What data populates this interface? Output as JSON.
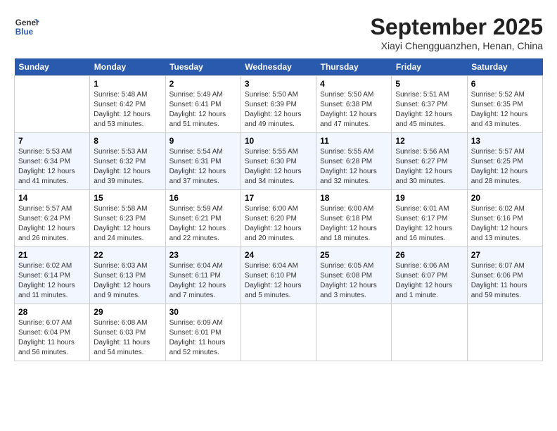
{
  "header": {
    "logo_line1": "General",
    "logo_line2": "Blue",
    "month": "September 2025",
    "location": "Xiayi Chengguanzhen, Henan, China"
  },
  "weekdays": [
    "Sunday",
    "Monday",
    "Tuesday",
    "Wednesday",
    "Thursday",
    "Friday",
    "Saturday"
  ],
  "weeks": [
    [
      {
        "day": "",
        "sunrise": "",
        "sunset": "",
        "daylight": ""
      },
      {
        "day": "1",
        "sunrise": "Sunrise: 5:48 AM",
        "sunset": "Sunset: 6:42 PM",
        "daylight": "Daylight: 12 hours and 53 minutes."
      },
      {
        "day": "2",
        "sunrise": "Sunrise: 5:49 AM",
        "sunset": "Sunset: 6:41 PM",
        "daylight": "Daylight: 12 hours and 51 minutes."
      },
      {
        "day": "3",
        "sunrise": "Sunrise: 5:50 AM",
        "sunset": "Sunset: 6:39 PM",
        "daylight": "Daylight: 12 hours and 49 minutes."
      },
      {
        "day": "4",
        "sunrise": "Sunrise: 5:50 AM",
        "sunset": "Sunset: 6:38 PM",
        "daylight": "Daylight: 12 hours and 47 minutes."
      },
      {
        "day": "5",
        "sunrise": "Sunrise: 5:51 AM",
        "sunset": "Sunset: 6:37 PM",
        "daylight": "Daylight: 12 hours and 45 minutes."
      },
      {
        "day": "6",
        "sunrise": "Sunrise: 5:52 AM",
        "sunset": "Sunset: 6:35 PM",
        "daylight": "Daylight: 12 hours and 43 minutes."
      }
    ],
    [
      {
        "day": "7",
        "sunrise": "Sunrise: 5:53 AM",
        "sunset": "Sunset: 6:34 PM",
        "daylight": "Daylight: 12 hours and 41 minutes."
      },
      {
        "day": "8",
        "sunrise": "Sunrise: 5:53 AM",
        "sunset": "Sunset: 6:32 PM",
        "daylight": "Daylight: 12 hours and 39 minutes."
      },
      {
        "day": "9",
        "sunrise": "Sunrise: 5:54 AM",
        "sunset": "Sunset: 6:31 PM",
        "daylight": "Daylight: 12 hours and 37 minutes."
      },
      {
        "day": "10",
        "sunrise": "Sunrise: 5:55 AM",
        "sunset": "Sunset: 6:30 PM",
        "daylight": "Daylight: 12 hours and 34 minutes."
      },
      {
        "day": "11",
        "sunrise": "Sunrise: 5:55 AM",
        "sunset": "Sunset: 6:28 PM",
        "daylight": "Daylight: 12 hours and 32 minutes."
      },
      {
        "day": "12",
        "sunrise": "Sunrise: 5:56 AM",
        "sunset": "Sunset: 6:27 PM",
        "daylight": "Daylight: 12 hours and 30 minutes."
      },
      {
        "day": "13",
        "sunrise": "Sunrise: 5:57 AM",
        "sunset": "Sunset: 6:25 PM",
        "daylight": "Daylight: 12 hours and 28 minutes."
      }
    ],
    [
      {
        "day": "14",
        "sunrise": "Sunrise: 5:57 AM",
        "sunset": "Sunset: 6:24 PM",
        "daylight": "Daylight: 12 hours and 26 minutes."
      },
      {
        "day": "15",
        "sunrise": "Sunrise: 5:58 AM",
        "sunset": "Sunset: 6:23 PM",
        "daylight": "Daylight: 12 hours and 24 minutes."
      },
      {
        "day": "16",
        "sunrise": "Sunrise: 5:59 AM",
        "sunset": "Sunset: 6:21 PM",
        "daylight": "Daylight: 12 hours and 22 minutes."
      },
      {
        "day": "17",
        "sunrise": "Sunrise: 6:00 AM",
        "sunset": "Sunset: 6:20 PM",
        "daylight": "Daylight: 12 hours and 20 minutes."
      },
      {
        "day": "18",
        "sunrise": "Sunrise: 6:00 AM",
        "sunset": "Sunset: 6:18 PM",
        "daylight": "Daylight: 12 hours and 18 minutes."
      },
      {
        "day": "19",
        "sunrise": "Sunrise: 6:01 AM",
        "sunset": "Sunset: 6:17 PM",
        "daylight": "Daylight: 12 hours and 16 minutes."
      },
      {
        "day": "20",
        "sunrise": "Sunrise: 6:02 AM",
        "sunset": "Sunset: 6:16 PM",
        "daylight": "Daylight: 12 hours and 13 minutes."
      }
    ],
    [
      {
        "day": "21",
        "sunrise": "Sunrise: 6:02 AM",
        "sunset": "Sunset: 6:14 PM",
        "daylight": "Daylight: 12 hours and 11 minutes."
      },
      {
        "day": "22",
        "sunrise": "Sunrise: 6:03 AM",
        "sunset": "Sunset: 6:13 PM",
        "daylight": "Daylight: 12 hours and 9 minutes."
      },
      {
        "day": "23",
        "sunrise": "Sunrise: 6:04 AM",
        "sunset": "Sunset: 6:11 PM",
        "daylight": "Daylight: 12 hours and 7 minutes."
      },
      {
        "day": "24",
        "sunrise": "Sunrise: 6:04 AM",
        "sunset": "Sunset: 6:10 PM",
        "daylight": "Daylight: 12 hours and 5 minutes."
      },
      {
        "day": "25",
        "sunrise": "Sunrise: 6:05 AM",
        "sunset": "Sunset: 6:08 PM",
        "daylight": "Daylight: 12 hours and 3 minutes."
      },
      {
        "day": "26",
        "sunrise": "Sunrise: 6:06 AM",
        "sunset": "Sunset: 6:07 PM",
        "daylight": "Daylight: 12 hours and 1 minute."
      },
      {
        "day": "27",
        "sunrise": "Sunrise: 6:07 AM",
        "sunset": "Sunset: 6:06 PM",
        "daylight": "Daylight: 11 hours and 59 minutes."
      }
    ],
    [
      {
        "day": "28",
        "sunrise": "Sunrise: 6:07 AM",
        "sunset": "Sunset: 6:04 PM",
        "daylight": "Daylight: 11 hours and 56 minutes."
      },
      {
        "day": "29",
        "sunrise": "Sunrise: 6:08 AM",
        "sunset": "Sunset: 6:03 PM",
        "daylight": "Daylight: 11 hours and 54 minutes."
      },
      {
        "day": "30",
        "sunrise": "Sunrise: 6:09 AM",
        "sunset": "Sunset: 6:01 PM",
        "daylight": "Daylight: 11 hours and 52 minutes."
      },
      {
        "day": "",
        "sunrise": "",
        "sunset": "",
        "daylight": ""
      },
      {
        "day": "",
        "sunrise": "",
        "sunset": "",
        "daylight": ""
      },
      {
        "day": "",
        "sunrise": "",
        "sunset": "",
        "daylight": ""
      },
      {
        "day": "",
        "sunrise": "",
        "sunset": "",
        "daylight": ""
      }
    ]
  ]
}
